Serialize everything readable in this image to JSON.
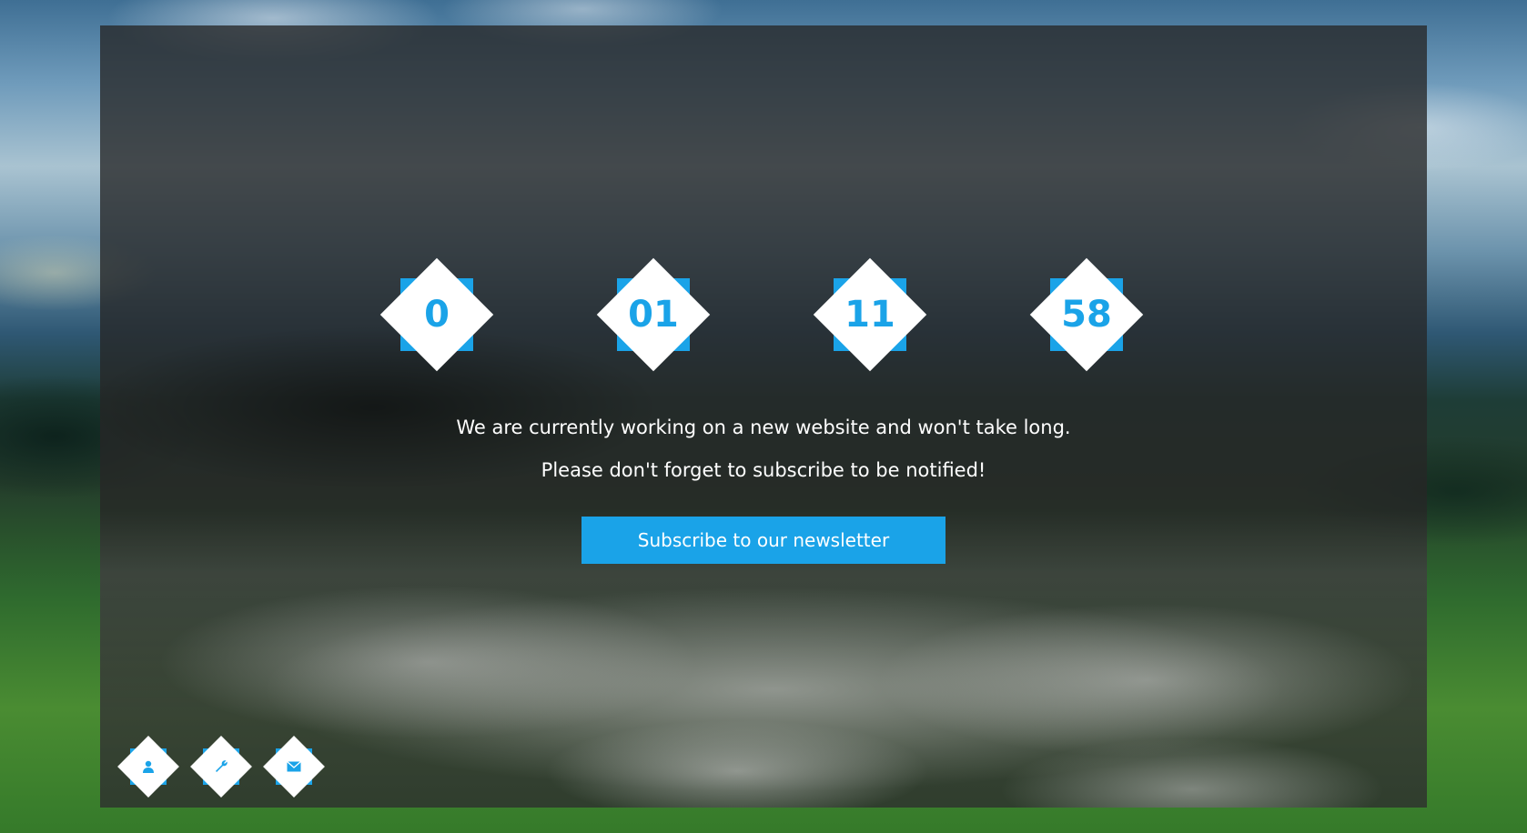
{
  "colors": {
    "accent": "#1aa3e8",
    "text": "#ffffff",
    "overlay": "#262626"
  },
  "countdown": {
    "units": [
      {
        "value": "0"
      },
      {
        "value": "01"
      },
      {
        "value": "11"
      },
      {
        "value": "58"
      }
    ]
  },
  "message": {
    "line1": "We are currently working on a new website and won't take long.",
    "line2": "Please don't forget to subscribe to be notified!"
  },
  "subscribe": {
    "label": "Subscribe to our newsletter"
  },
  "social": {
    "icons": [
      "user-icon",
      "wrench-icon",
      "envelope-icon"
    ]
  }
}
